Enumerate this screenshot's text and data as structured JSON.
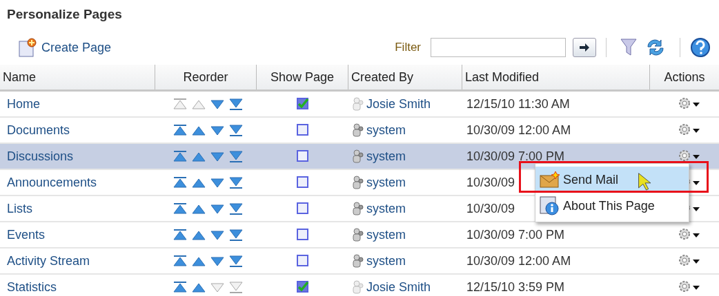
{
  "title": "Personalize Pages",
  "toolbar": {
    "create_label": "Create Page",
    "filter_label": "Filter"
  },
  "columns": [
    "Name",
    "Reorder",
    "Show Page",
    "Created By",
    "Last Modified",
    "Actions"
  ],
  "rows": [
    {
      "name": "Home",
      "selected": false,
      "reorder": [
        false,
        false,
        true,
        true
      ],
      "show": true,
      "created_by": "Josie Smith",
      "icon_faded": true,
      "modified": "12/15/10 11:30 AM"
    },
    {
      "name": "Documents",
      "selected": false,
      "reorder": [
        true,
        true,
        true,
        true
      ],
      "show": false,
      "created_by": "system",
      "icon_faded": false,
      "modified": "10/30/09 12:00 AM"
    },
    {
      "name": "Discussions",
      "selected": true,
      "reorder": [
        true,
        true,
        true,
        true
      ],
      "show": false,
      "created_by": "system",
      "icon_faded": false,
      "modified": "10/30/09 7:00 PM"
    },
    {
      "name": "Announcements",
      "selected": false,
      "reorder": [
        true,
        true,
        true,
        true
      ],
      "show": false,
      "created_by": "system",
      "icon_faded": false,
      "modified": "10/30/09"
    },
    {
      "name": "Lists",
      "selected": false,
      "reorder": [
        true,
        true,
        true,
        true
      ],
      "show": false,
      "created_by": "system",
      "icon_faded": false,
      "modified": "10/30/09"
    },
    {
      "name": "Events",
      "selected": false,
      "reorder": [
        true,
        true,
        true,
        true
      ],
      "show": false,
      "created_by": "system",
      "icon_faded": false,
      "modified": "10/30/09 7:00 PM"
    },
    {
      "name": "Activity Stream",
      "selected": false,
      "reorder": [
        true,
        true,
        true,
        true
      ],
      "show": false,
      "created_by": "system",
      "icon_faded": false,
      "modified": "10/30/09 12:00 AM"
    },
    {
      "name": "Statistics",
      "selected": false,
      "reorder": [
        true,
        true,
        false,
        false
      ],
      "show": true,
      "created_by": "Josie Smith",
      "icon_faded": true,
      "modified": "12/15/10 3:59 PM"
    }
  ],
  "menu": {
    "items": [
      {
        "label": "Send Mail",
        "kind": "mail",
        "selected": true
      },
      {
        "label": "About This Page",
        "kind": "info",
        "selected": false
      }
    ]
  }
}
